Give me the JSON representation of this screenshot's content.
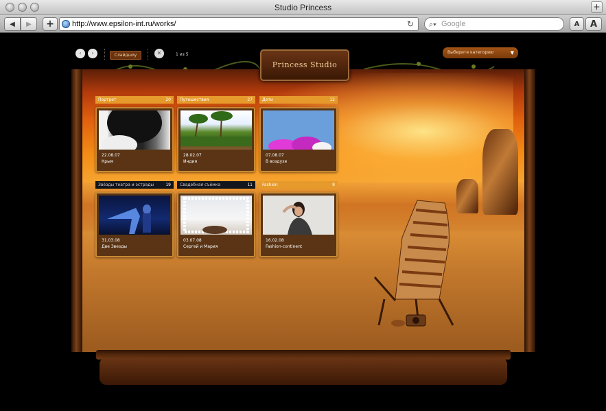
{
  "window": {
    "title": "Studio Princess"
  },
  "toolbar": {
    "back_label": "◀",
    "forward_label": "▶",
    "add_label": "+",
    "url": "http://www.epsilon-int.ru/works/",
    "reload_label": "↻",
    "search_placeholder": "Google",
    "font_smaller": "A",
    "font_larger": "A"
  },
  "tab_plus": "+",
  "site": {
    "logo": "Princess Studio",
    "prev_label": "‹",
    "next_label": "›",
    "slideshow_label": "Слайдшоу",
    "close_label": "✕",
    "counter": "1 из 5",
    "category_select": "Выберите категорию",
    "category_arrow": "▼"
  },
  "gallery": [
    {
      "category": "Портрет",
      "count": "20",
      "date": "22.08.07",
      "title": "Крым",
      "header_style": "orange"
    },
    {
      "category": "Путешествия",
      "count": "27",
      "date": "28.02.07",
      "title": "Индия",
      "header_style": "orange"
    },
    {
      "category": "Дети",
      "count": "12",
      "date": "07.08.07",
      "title": "В воздухе",
      "header_style": "orange"
    },
    {
      "category": "Звёзды театра и эстрады",
      "count": "19",
      "date": "31.03.08",
      "title": "Две Звезды",
      "header_style": "dark"
    },
    {
      "category": "Свадебная съёмка",
      "count": "11",
      "date": "03.07.08",
      "title": "Сергей и Мария",
      "header_style": "dark"
    },
    {
      "category": "Fashion",
      "count": "8",
      "date": "16.02.08",
      "title": "Fashion-continent",
      "header_style": "orange"
    }
  ],
  "colors": {
    "accent": "#e69a2c",
    "tile_bg": "#5a3414",
    "frame_border": "#c98a35"
  }
}
